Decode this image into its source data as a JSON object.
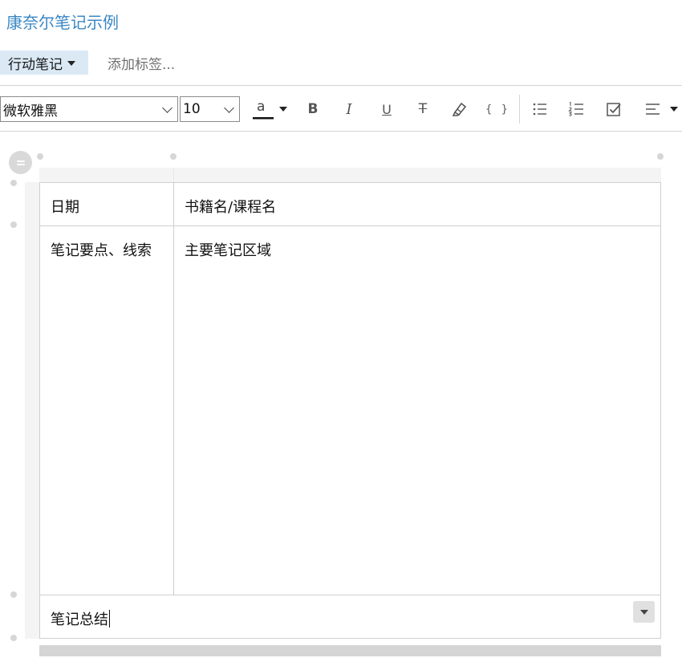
{
  "note": {
    "title": "康奈尔笔记示例"
  },
  "notebook": {
    "label": "行动笔记"
  },
  "tags": {
    "placeholder": "添加标签..."
  },
  "toolbar": {
    "font": "微软雅黑",
    "size": "10",
    "text_color_glyph": "a",
    "bold_glyph": "B",
    "italic_glyph": "I",
    "underline_glyph": "U",
    "strike_glyph": "T",
    "code_glyph": "{ }"
  },
  "table": {
    "cells": {
      "date": "日期",
      "book": "书籍名/课程名",
      "cues": "笔记要点、线索",
      "main": "主要笔记区域",
      "summary": "笔记总结"
    }
  },
  "colors": {
    "title": "#3c88c4",
    "notebook_bg": "#dbe9f5"
  }
}
